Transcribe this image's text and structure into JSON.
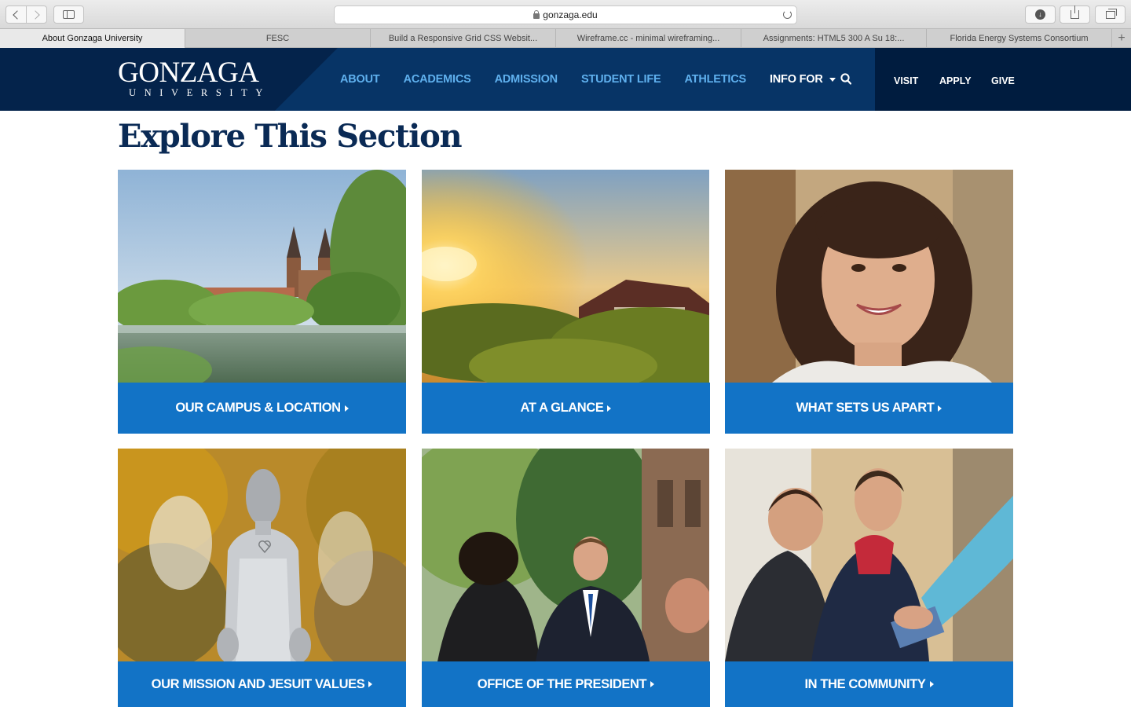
{
  "browser": {
    "url": "gonzaga.edu",
    "tabs": [
      {
        "label": "About Gonzaga University",
        "active": true
      },
      {
        "label": "FESC",
        "active": false
      },
      {
        "label": "Build a Responsive Grid CSS Websit...",
        "active": false
      },
      {
        "label": "Wireframe.cc - minimal wireframing...",
        "active": false
      },
      {
        "label": "Assignments: HTML5 300 A Su 18:...",
        "active": false
      },
      {
        "label": "Florida Energy Systems Consortium",
        "active": false
      }
    ],
    "new_tab": "+"
  },
  "site": {
    "logo_main": "GONZAGA",
    "logo_sub": "UNIVERSITY",
    "nav": [
      "ABOUT",
      "ACADEMICS",
      "ADMISSION",
      "STUDENT LIFE",
      "ATHLETICS"
    ],
    "info_for": "INFO FOR",
    "utility": [
      "VISIT",
      "APPLY",
      "GIVE"
    ],
    "colors": {
      "header": "#002a58",
      "utility": "#001c3f",
      "nav_link": "#5fb0ee",
      "card_label": "#1273c6",
      "title": "#0a2a55"
    }
  },
  "section_title": "Explore This Section",
  "cards": [
    {
      "label": "OUR CAMPUS & LOCATION",
      "image": "campus-photo"
    },
    {
      "label": "AT A GLANCE",
      "image": "sunset-photo"
    },
    {
      "label": "WHAT SETS US APART",
      "image": "student-photo"
    },
    {
      "label": "OUR MISSION AND JESUIT VALUES",
      "image": "statue-photo"
    },
    {
      "label": "OFFICE OF THE PRESIDENT",
      "image": "president-photo"
    },
    {
      "label": "IN THE COMMUNITY",
      "image": "community-photo"
    }
  ]
}
